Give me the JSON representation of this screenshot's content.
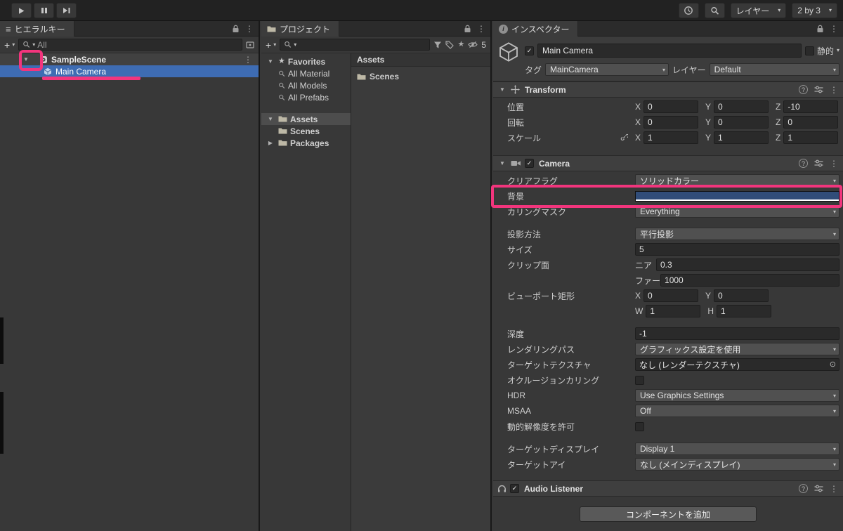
{
  "colors": {
    "annotation_pink": "#F2357D",
    "selection_blue": "#3E6CB3",
    "background_swatch": "#314D79"
  },
  "icons": {
    "caret_down": "▾",
    "foldout_open": "▼",
    "foldout_closed": "▶",
    "kebab": "⋮",
    "plus": "+",
    "star": "★",
    "check": "✓",
    "object_picker": "⊙",
    "menu": "≡",
    "info": "i",
    "help": "?"
  },
  "topbar": {
    "layers_dropdown": "レイヤー",
    "layout_dropdown": "2 by 3"
  },
  "hierarchy": {
    "tab": "ヒエラルキー",
    "search_value": "All",
    "scene_name": "SampleScene",
    "children": [
      {
        "name": "Main Camera"
      }
    ]
  },
  "project": {
    "tab": "プロジェクト",
    "favorites_label": "Favorites",
    "favorites_items": [
      "All Material",
      "All Models",
      "All Prefabs"
    ],
    "assets_label": "Assets",
    "scenes_label": "Scenes",
    "packages_label": "Packages",
    "pane_header": "Assets",
    "pane_items": [
      "Scenes"
    ],
    "hidden_count": "5"
  },
  "inspector": {
    "tab": "インスペクター",
    "name": "Main Camera",
    "static_label": "静的",
    "tag_label": "タグ",
    "tag_value": "MainCamera",
    "layer_label": "レイヤー",
    "layer_value": "Default",
    "axis": {
      "x": "X",
      "y": "Y",
      "z": "Z",
      "w": "W",
      "h": "H"
    },
    "transform": {
      "title": "Transform",
      "position": {
        "label": "位置",
        "x": "0",
        "y": "0",
        "z": "-10"
      },
      "rotation": {
        "label": "回転",
        "x": "0",
        "y": "0",
        "z": "0"
      },
      "scale": {
        "label": "スケール",
        "x": "1",
        "y": "1",
        "z": "1"
      }
    },
    "camera": {
      "title": "Camera",
      "clear_flags": {
        "label": "クリアフラグ",
        "value": "ソリッドカラー"
      },
      "background": {
        "label": "背景"
      },
      "culling_mask": {
        "label": "カリングマスク",
        "value": "Everything"
      },
      "projection": {
        "label": "投影方法",
        "value": "平行投影"
      },
      "size": {
        "label": "サイズ",
        "value": "5"
      },
      "clipping": {
        "label": "クリップ面",
        "near_label": "ニア",
        "near": "0.3",
        "far_label": "ファー",
        "far": "1000"
      },
      "viewport": {
        "label": "ビューポート矩形",
        "x": "0",
        "y": "0",
        "w": "1",
        "h": "1"
      },
      "depth": {
        "label": "深度",
        "value": "-1"
      },
      "rendering_path": {
        "label": "レンダリングパス",
        "value": "グラフィックス設定を使用"
      },
      "target_texture": {
        "label": "ターゲットテクスチャ",
        "value": "なし (レンダーテクスチャ)"
      },
      "occlusion": {
        "label": "オクルージョンカリング"
      },
      "hdr": {
        "label": "HDR",
        "value": "Use Graphics Settings"
      },
      "msaa": {
        "label": "MSAA",
        "value": "Off"
      },
      "dynamic_resolution": {
        "label": "動的解像度を許可"
      },
      "target_display": {
        "label": "ターゲットディスプレイ",
        "value": "Display 1"
      },
      "target_eye": {
        "label": "ターゲットアイ",
        "value": "なし (メインディスプレイ)"
      }
    },
    "audio_listener": {
      "title": "Audio Listener"
    },
    "add_component": "コンポーネントを追加"
  }
}
